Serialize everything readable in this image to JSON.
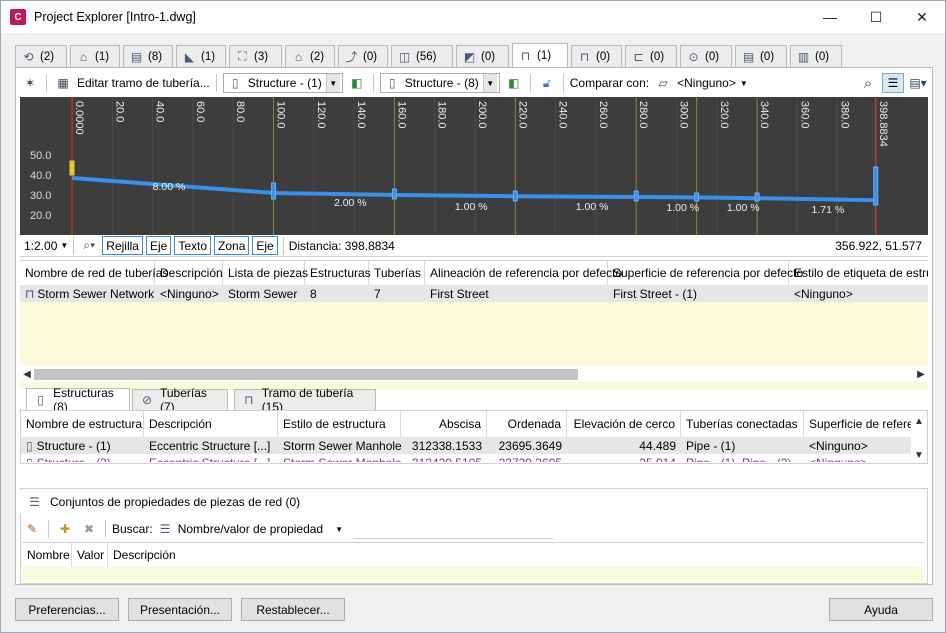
{
  "window": {
    "app_icon_text": "C",
    "title": "Project Explorer [Intro-1.dwg]",
    "minimize": "—",
    "maximize": "☐",
    "close": "✕"
  },
  "top_tabs": [
    {
      "icon": "alignment-icon",
      "glyph": "⟲",
      "count": "(2)"
    },
    {
      "icon": "bridge-icon",
      "glyph": "⌂",
      "count": "(1)"
    },
    {
      "icon": "surface-icon",
      "glyph": "▤",
      "count": "(8)"
    },
    {
      "icon": "corridor-icon",
      "glyph": "◣",
      "count": "(1)"
    },
    {
      "icon": "parcel-icon",
      "glyph": "⛶",
      "count": "(3)"
    },
    {
      "icon": "site-icon",
      "glyph": "⌂",
      "count": "(2)"
    },
    {
      "icon": "profile-icon",
      "glyph": "⤴",
      "count": "(0)"
    },
    {
      "icon": "pipe-network-icon",
      "glyph": "◫",
      "count": "(56)"
    },
    {
      "icon": "grading-icon",
      "glyph": "◩",
      "count": "(0)"
    },
    {
      "icon": "pipe-run-icon",
      "glyph": "⊓",
      "count": "(1)"
    },
    {
      "icon": "pressure-network-icon",
      "glyph": "⊓",
      "count": "(0)"
    },
    {
      "icon": "feature-line-icon",
      "glyph": "⊏",
      "count": "(0)"
    },
    {
      "icon": "catchment-icon",
      "glyph": "⊙",
      "count": "(0)"
    },
    {
      "icon": "sheet-icon",
      "glyph": "▤",
      "count": "(0)"
    },
    {
      "icon": "building-icon",
      "glyph": "▥",
      "count": "(0)"
    }
  ],
  "toolbar": {
    "edit_label": "Editar tramo de tubería...",
    "structure_start": "Structure - (1)",
    "structure_end": "Structure - (8)",
    "compare_label": "Comparar con:",
    "compare_value": "<Ninguno>"
  },
  "profile": {
    "y_labels": [
      "50.0",
      "40.0",
      "30.0",
      "20.0"
    ],
    "x_labels": [
      "0.0000",
      "20.0",
      "40.0",
      "60.0",
      "80.0",
      "100.0",
      "120.0",
      "140.0",
      "160.0",
      "180.0",
      "200.0",
      "220.0",
      "240.0",
      "260.0",
      "280.0",
      "300.0",
      "320.0",
      "340.0",
      "360.0",
      "380.0",
      "398.8834"
    ],
    "slopes": [
      "8.00 %",
      "2.00 %",
      "1.00 %",
      "1.00 %",
      "1.00 %",
      "1.00 %",
      "1.71 %"
    ]
  },
  "profile_status": {
    "scale": "1:2.00",
    "toggles": [
      "Rejilla",
      "Eje",
      "Texto",
      "Zona",
      "Eje"
    ],
    "distance": "Distancia: 398.8834",
    "coords": "356.922, 51.577"
  },
  "network_table": {
    "headers": [
      "Nombre de red de tuberías",
      "Descripción",
      "Lista de piezas",
      "Estructuras",
      "Tuberías",
      "Alineación de referencia por defecto",
      "Superficie de referencia por defecto",
      "Estilo de etiqueta de estruct"
    ],
    "row": [
      "Storm Sewer Network",
      "<Ninguno>",
      "Storm Sewer",
      "8",
      "7",
      "First Street",
      "First Street - (1)",
      "<Ninguno>"
    ]
  },
  "sub_tabs": [
    "Estructuras (8)",
    "Tuberías (7)",
    "Tramo de tubería (15)"
  ],
  "structure_table": {
    "headers": [
      "Nombre de estructura",
      "Descripción",
      "Estilo de estructura",
      "Abscisa",
      "Ordenada",
      "Elevación de cerco",
      "Tuberías conectadas",
      "Superficie de refere"
    ],
    "rows": [
      [
        "Structure - (1)",
        "Eccentric Structure  [...]",
        "Storm Sewer Manhole",
        "312338.1533",
        "23695.3649",
        "44.489",
        "Pipe - (1)",
        "<Ninguno>"
      ],
      [
        "Structure - (2)",
        "Eccentric Structure  [...]",
        "Storm Sewer Manhole",
        "312420.5105",
        "23739.3605",
        "35.914",
        "Pipe - (1), Pipe - (2)",
        "<Ninguno>"
      ]
    ]
  },
  "property_sets": {
    "tab": "Conjuntos de propiedades de piezas de red (0)",
    "search_label": "Buscar:",
    "search_value": "Nombre/valor de propiedad",
    "headers": [
      "Nombre",
      "Valor",
      "Descripción"
    ]
  },
  "buttons": {
    "prefs": "Preferencias...",
    "presentation": "Presentación...",
    "reset": "Restablecer...",
    "help": "Ayuda"
  }
}
